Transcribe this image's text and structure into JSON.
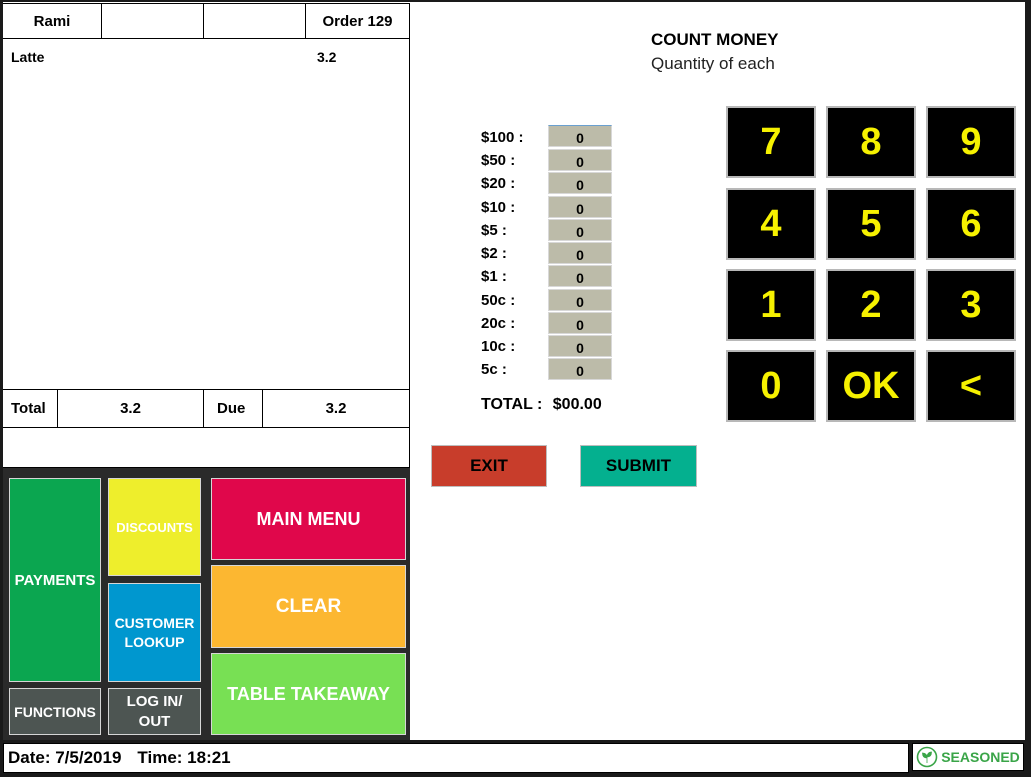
{
  "header": {
    "user": "Rami",
    "col2": "",
    "col3": "",
    "order": "Order 129"
  },
  "order_items": [
    {
      "name": "Latte",
      "price": "3.2"
    }
  ],
  "totals": {
    "total_label": "Total",
    "total_value": "3.2",
    "due_label": "Due",
    "due_value": "3.2"
  },
  "buttons": {
    "payments": "PAYMENTS",
    "functions": "FUNCTIONS",
    "discounts": "DISCOUNTS",
    "customer_lookup": "CUSTOMER LOOKUP",
    "login_out": "LOG IN/ OUT",
    "main_menu": "MAIN MENU",
    "clear": "CLEAR",
    "table_takeaway": "TABLE TAKEAWAY"
  },
  "footer": {
    "date": "Date: 7/5/2019",
    "time": "Time: 18:21",
    "logo": "SEASONED"
  },
  "count_money": {
    "title": "COUNT MONEY",
    "subtitle": "Quantity of each",
    "denominations": [
      {
        "label": "$100 :",
        "qty": "0"
      },
      {
        "label": "$50 :",
        "qty": "0"
      },
      {
        "label": "$20 :",
        "qty": "0"
      },
      {
        "label": "$10 :",
        "qty": "0"
      },
      {
        "label": "$5 :",
        "qty": "0"
      },
      {
        "label": "$2 :",
        "qty": "0"
      },
      {
        "label": "$1 :",
        "qty": "0"
      },
      {
        "label": "50c :",
        "qty": "0"
      },
      {
        "label": "20c :",
        "qty": "0"
      },
      {
        "label": "10c :",
        "qty": "0"
      },
      {
        "label": "5c :",
        "qty": "0"
      }
    ],
    "total_label": "TOTAL :",
    "total_value": "$00.00",
    "exit_label": "EXIT",
    "submit_label": "SUBMIT"
  },
  "keypad": [
    "7",
    "8",
    "9",
    "4",
    "5",
    "6",
    "1",
    "2",
    "3",
    "0",
    "OK",
    "<"
  ],
  "colors": {
    "payments": "#0ba650",
    "discounts": "#eeee2c",
    "customer_lookup": "#0097cf",
    "main_menu": "#e0074b",
    "clear": "#fcb731",
    "table_takeaway": "#78e054",
    "functions": "#4d5552",
    "exit": "#c83d2b",
    "submit": "#04b08f",
    "key_text": "#f6f100",
    "qty_box": "#bcbba9"
  }
}
